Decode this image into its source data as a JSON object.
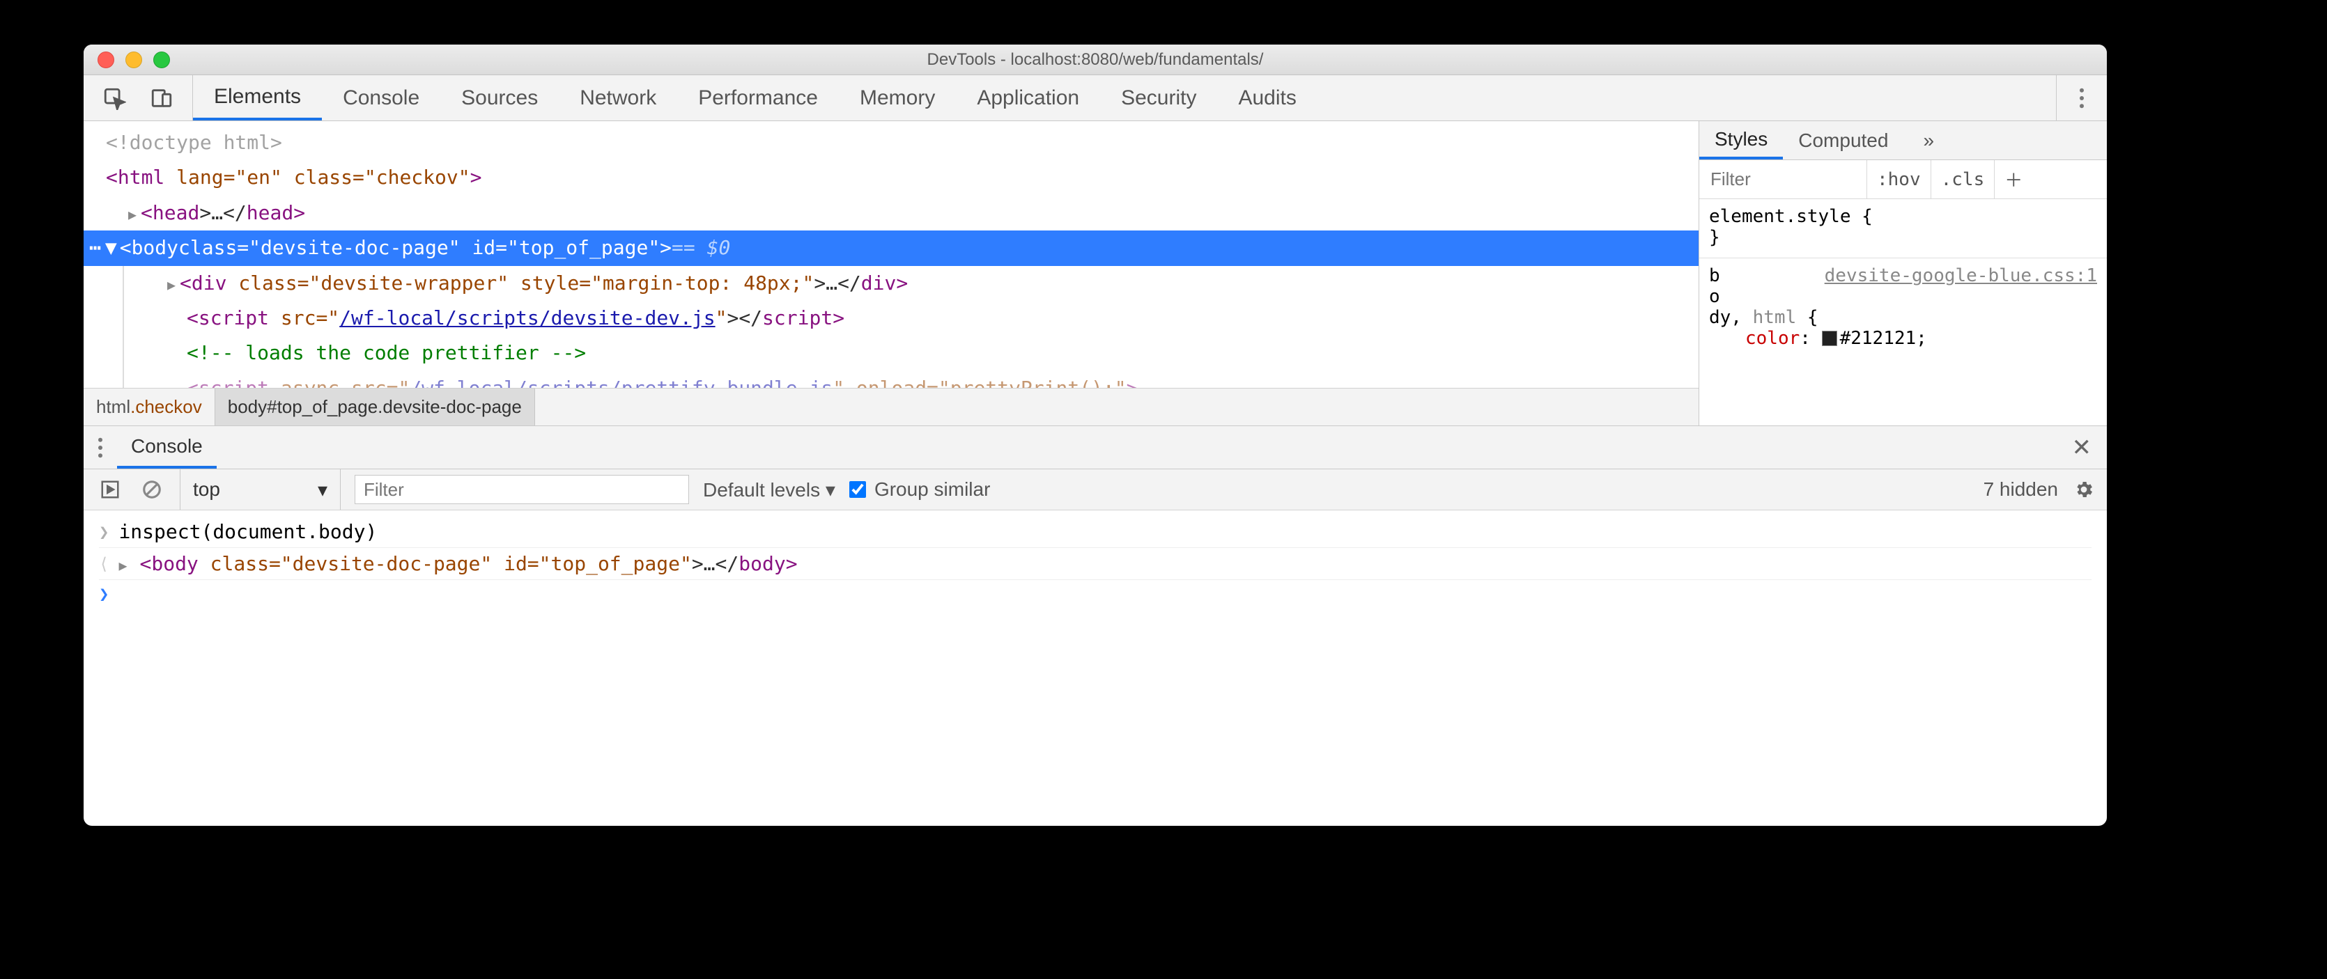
{
  "window": {
    "title": "DevTools - localhost:8080/web/fundamentals/"
  },
  "toolbar": {
    "tabs": [
      "Elements",
      "Console",
      "Sources",
      "Network",
      "Performance",
      "Memory",
      "Application",
      "Security",
      "Audits"
    ],
    "active": 0
  },
  "dom": {
    "l0": "<!doctype html>",
    "l1_open": "<",
    "l1_tag": "html",
    "l1_attrs": " lang=\"en\" class=\"checkov\"",
    "l1_close": ">",
    "l2_open": "<",
    "l2_tag": "head",
    "l2_mid": ">…</",
    "l2_tag2": "head",
    "l2_end": ">",
    "sel_open": "<",
    "sel_tag": "body",
    "sel_attrs": " class=\"devsite-doc-page\"  id=\"top_of_page\"",
    "sel_close": ">",
    "sel_eq": " == ",
    "sel_dz": "$0",
    "c1_open": "<",
    "c1_tag": "div",
    "c1_attrs": " class=\"devsite-wrapper\" style=\"margin-top: 48px;\"",
    "c1_mid": ">…</",
    "c1_tag2": "div",
    "c1_end": ">",
    "c2_open": "<",
    "c2_tag": "script",
    "c2_attrs_a": " src=\"",
    "c2_url": "/wf-local/scripts/devsite-dev.js",
    "c2_attrs_b": "\"",
    "c2_mid": "></",
    "c2_tag2": "script",
    "c2_end": ">",
    "c3": "<!-- loads the code prettifier -->",
    "c4_open": "<",
    "c4_tag": "script",
    "c4_attrs_a": " async src=\"",
    "c4_url": "/wf-local/scripts/prettify-bundle.js",
    "c4_attrs_b": "\" onload=\"prettyPrint();\"",
    "c4_end": ">"
  },
  "crumbs": {
    "a": "html",
    "a_cls": ".checkov",
    "b": "body#top_of_page.devsite-doc-page"
  },
  "styles": {
    "tabs": [
      "Styles",
      "Computed"
    ],
    "filter_ph": "Filter",
    "hov": ":hov",
    "cls": ".cls",
    "r1_sel": "element.style {",
    "r1_close": "}",
    "r2_src": "devsite-google-blue.css:1",
    "r2_sel_a": "b",
    "r2_sel_b": "o",
    "r2_sel_c": "dy, ",
    "r2_sel_d": "html",
    " r2_open": " {",
    "r2_prop": "color",
    "r2_val": "#212121"
  },
  "console": {
    "tab": "Console",
    "context": "top",
    "filter_ph": "Filter",
    "levels": "Default levels",
    "group": "Group similar",
    "hidden": "7 hidden",
    "row1": "inspect(document.body)",
    "row2_open": "<",
    "row2_tag": "body",
    "row2_attrs": " class=\"devsite-doc-page\" id=\"top_of_page\"",
    "row2_mid": ">…</",
    "row2_tag2": "body",
    "row2_end": ">"
  }
}
